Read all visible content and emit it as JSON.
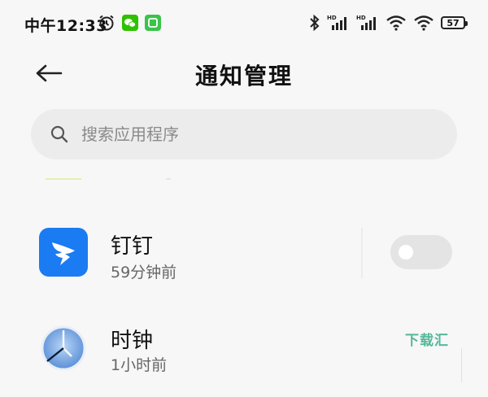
{
  "status_bar": {
    "time": "中午12:33",
    "battery_level": "57",
    "icons": [
      "alarm-icon",
      "wechat-icon",
      "green-app-icon",
      "bluetooth-icon",
      "hd-signal-icon",
      "hd-signal-icon",
      "wifi-icon",
      "wifi-icon",
      "battery-icon"
    ]
  },
  "header": {
    "title": "通知管理",
    "back_icon": "back-arrow-icon"
  },
  "search": {
    "placeholder": "搜索应用程序",
    "icon": "search-icon"
  },
  "apps": [
    {
      "name": "钉钉",
      "time": "59分钟前",
      "icon": "dingtalk-icon",
      "color": "#1a7bf2",
      "toggle_on": false
    },
    {
      "name": "时钟",
      "time": "1小时前",
      "icon": "clock-icon",
      "color": "#5b8fd6"
    }
  ],
  "watermark": "下载汇"
}
